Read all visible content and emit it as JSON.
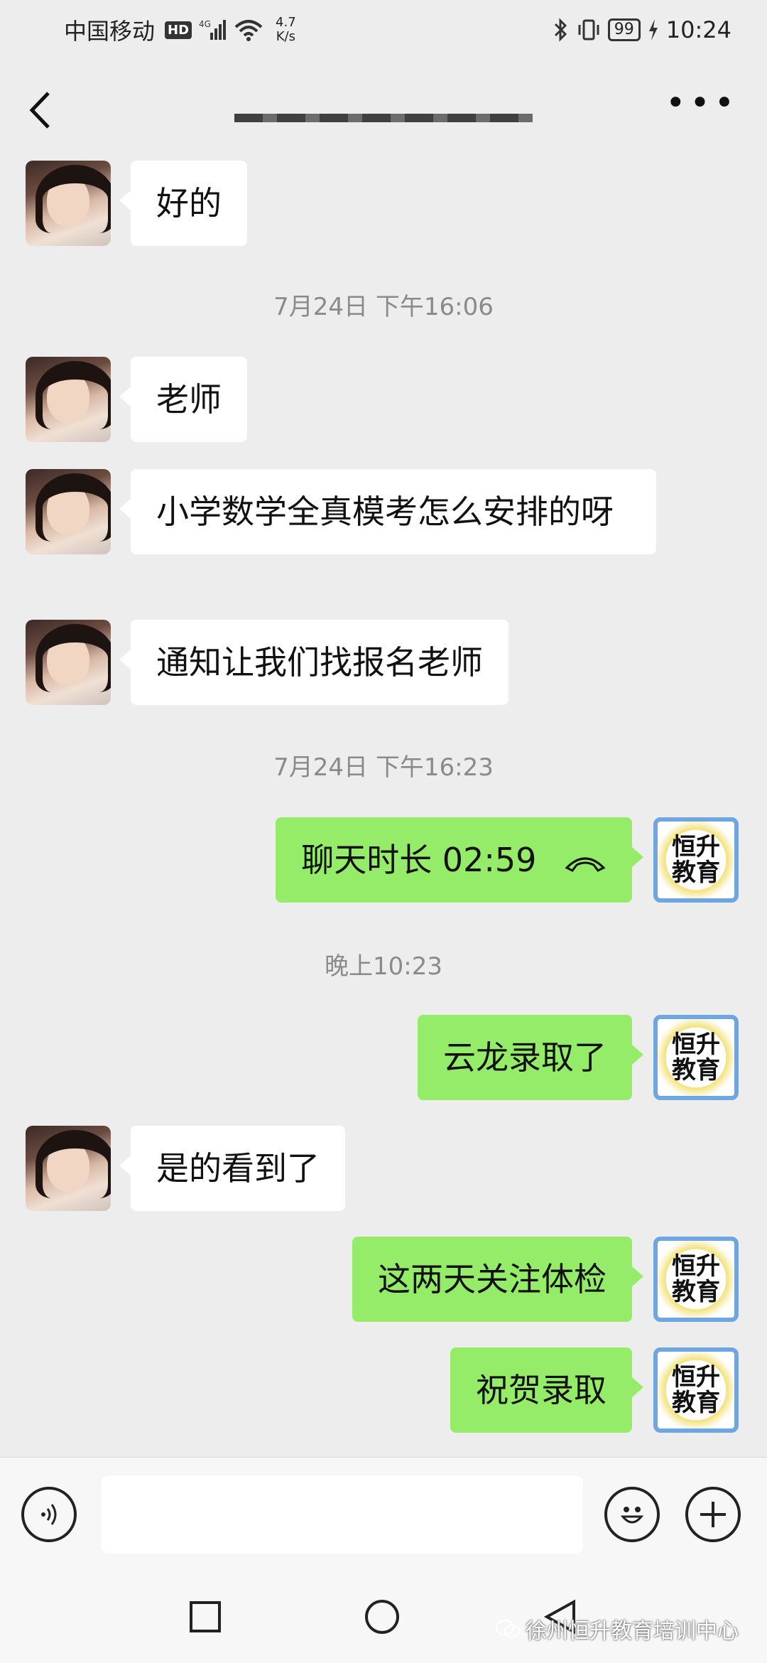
{
  "status_bar": {
    "carrier": "中国移动",
    "hd": "HD",
    "net_speed_value": "4.7",
    "net_speed_unit": "K/s",
    "battery": "99",
    "time": "10:24"
  },
  "messages": [
    {
      "side": "left",
      "text": "好的"
    },
    {
      "type": "time",
      "text": "7月24日 下午16:06"
    },
    {
      "side": "left",
      "text": "老师"
    },
    {
      "side": "left",
      "text": "小学数学全真模考怎么安排的呀"
    },
    {
      "side": "left",
      "text": "通知让我们找报名老师"
    },
    {
      "type": "time",
      "text": "7月24日 下午16:23"
    },
    {
      "side": "right",
      "text": "聊天时长 02:59"
    },
    {
      "type": "time",
      "text": "晚上10:23"
    },
    {
      "side": "right",
      "text": "云龙录取了"
    },
    {
      "side": "left",
      "text": "是的看到了"
    },
    {
      "side": "right",
      "text": "这两天关注体检"
    },
    {
      "side": "right",
      "text": "祝贺录取"
    }
  ],
  "logo": {
    "line1": "恒升",
    "line2": "教育"
  },
  "watermark": "徐州恒升教育培训中心"
}
